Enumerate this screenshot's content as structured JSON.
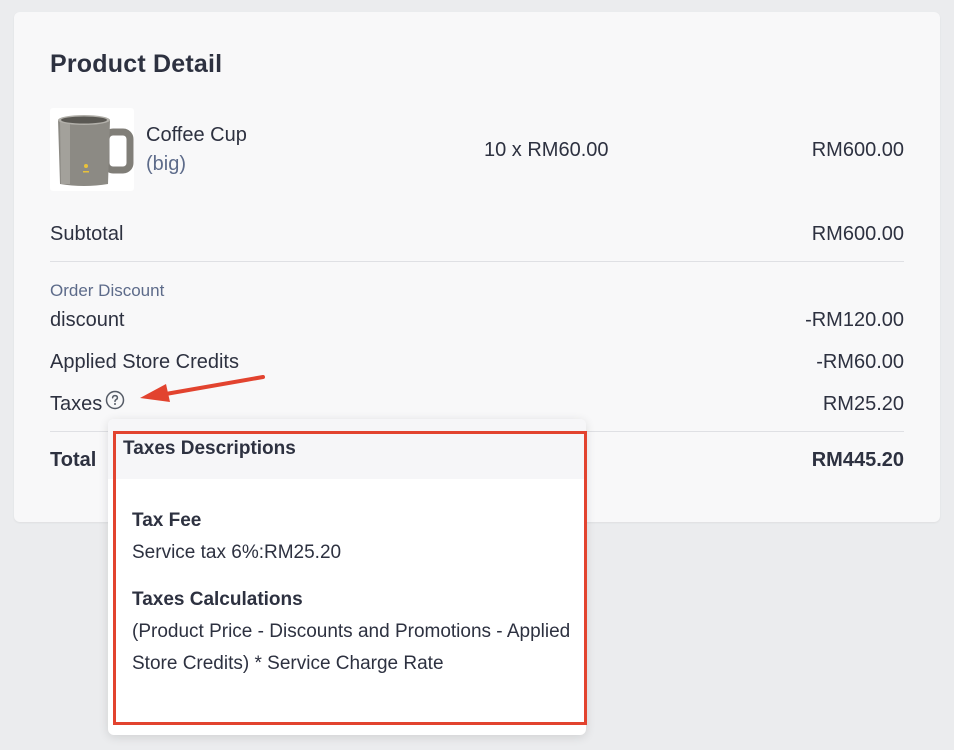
{
  "page": {
    "title": "Product Detail"
  },
  "product": {
    "name": "Coffee Cup",
    "variant": "(big)",
    "qty_price": "10 x RM60.00",
    "amount": "RM600.00"
  },
  "subtotal": {
    "label": "Subtotal",
    "value": "RM600.00"
  },
  "order_discount": {
    "heading": "Order Discount",
    "label": "discount",
    "value": "-RM120.00"
  },
  "store_credits": {
    "label": "Applied Store Credits",
    "value": "-RM60.00"
  },
  "taxes": {
    "label": "Taxes",
    "value": "RM25.20",
    "icon": "question-circle-icon"
  },
  "total": {
    "label": "Total",
    "value": "RM445.20"
  },
  "popover": {
    "title": "Taxes Descriptions",
    "fee_heading": "Tax Fee",
    "fee_text": "Service tax 6%:RM25.20",
    "calc_heading": "Taxes Calculations",
    "calc_text": "(Product Price - Discounts and Promotions - Applied Store Credits) * Service Charge Rate"
  },
  "colors": {
    "annotation_red": "#e2432f",
    "muted_blue": "#5d6b8a"
  }
}
